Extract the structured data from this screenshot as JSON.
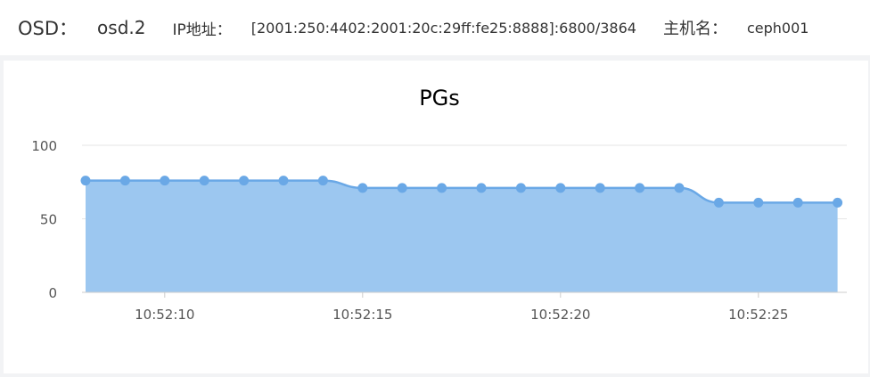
{
  "header": {
    "osd_label": "OSD：",
    "osd_value": "osd.2",
    "ip_label": "IP地址：",
    "ip_value": "[2001:250:4402:2001:20c:29ff:fe25:8888]:6800/3864",
    "host_label": "主机名：",
    "host_value": "ceph001"
  },
  "colors": {
    "area_fill": "#9cc7f0",
    "line": "#6aa8e6",
    "point": "#6aa8e6",
    "grid": "#e6e6e6",
    "axis_text": "#555555",
    "title_text": "#333333"
  },
  "chart_data": {
    "type": "area",
    "title": "PGs",
    "xlabel": "",
    "ylabel": "",
    "ylim": [
      0,
      100
    ],
    "yticks": [
      0,
      50,
      100
    ],
    "x": [
      "10:52:08",
      "10:52:09",
      "10:52:10",
      "10:52:11",
      "10:52:12",
      "10:52:13",
      "10:52:14",
      "10:52:15",
      "10:52:16",
      "10:52:17",
      "10:52:18",
      "10:52:19",
      "10:52:20",
      "10:52:21",
      "10:52:22",
      "10:52:23",
      "10:52:24",
      "10:52:25",
      "10:52:26",
      "10:52:27"
    ],
    "xtick_labels": [
      "10:52:10",
      "10:52:15",
      "10:52:20",
      "10:52:25"
    ],
    "series": [
      {
        "values": [
          76,
          76,
          76,
          76,
          76,
          76,
          76,
          71,
          71,
          71,
          71,
          71,
          71,
          71,
          71,
          71,
          61,
          61,
          61,
          61
        ]
      }
    ],
    "grid": true,
    "legend": "none"
  }
}
